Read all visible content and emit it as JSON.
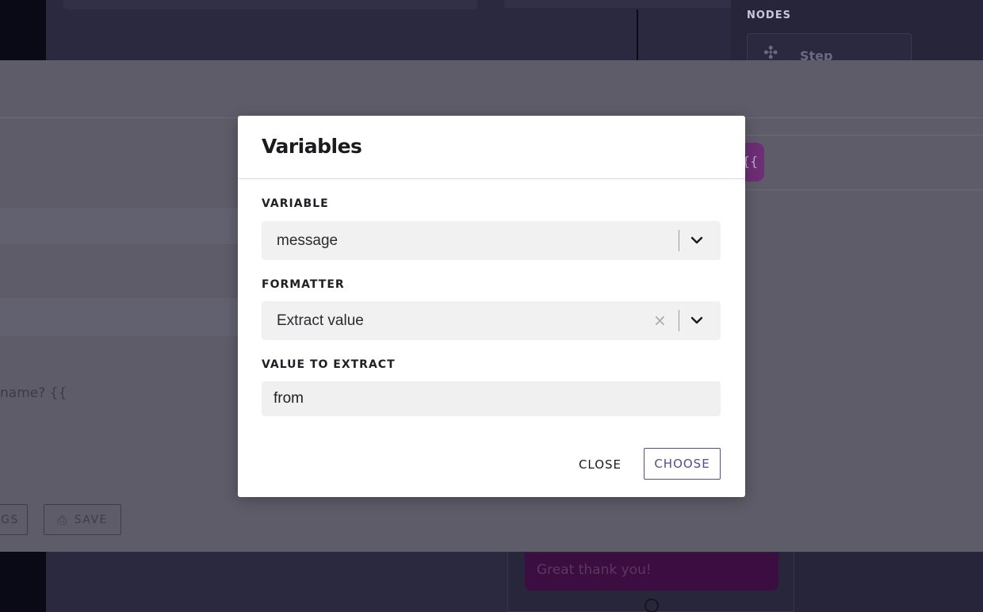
{
  "background": {
    "nodes_label": "NODES",
    "node_item_label": "Step",
    "panel_text": "name? {{",
    "settings_button_label": "GS",
    "save_button_label": "SAVE",
    "variable_chip": "{{",
    "chat_bubble_text": "Great thank you!"
  },
  "modal": {
    "title": "Variables",
    "variable": {
      "label": "VARIABLE",
      "value": "message"
    },
    "formatter": {
      "label": "FORMATTER",
      "value": "Extract value",
      "clear_symbol": "×"
    },
    "value_to_extract": {
      "label": "VALUE TO EXTRACT",
      "value": "from"
    },
    "close_label": "CLOSE",
    "choose_label": "CHOOSE"
  },
  "colors": {
    "accent": "#5c4a8a",
    "modal_bg": "#ffffff",
    "field_bg": "#f1f1f1",
    "overlay": "#5d5c68"
  }
}
